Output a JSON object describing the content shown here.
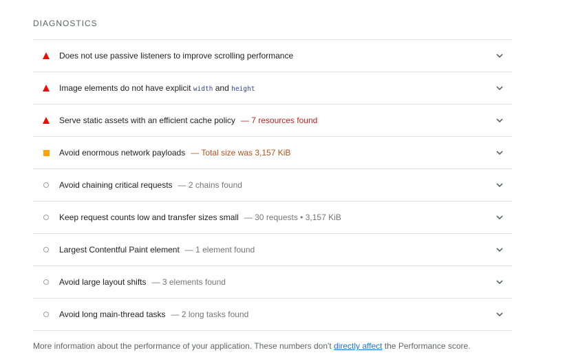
{
  "section": {
    "title": "DIAGNOSTICS"
  },
  "audits": [
    {
      "title": "Does not use passive listeners to improve scrolling performance",
      "display_value": "",
      "status": "fail"
    },
    {
      "title_before": "Image elements do not have explicit ",
      "code_1": "width",
      "title_middle": " and ",
      "code_2": "height",
      "display_value": "",
      "status": "fail"
    },
    {
      "title": "Serve static assets with an efficient cache policy",
      "display_value": "— 7 resources found",
      "status": "fail"
    },
    {
      "title": "Avoid enormous network payloads",
      "display_value": "— Total size was 3,157 KiB",
      "status": "average"
    },
    {
      "title": "Avoid chaining critical requests",
      "display_value": "— 2 chains found",
      "status": "informative"
    },
    {
      "title": "Keep request counts low and transfer sizes small",
      "display_value": "— 30 requests • 3,157 KiB",
      "status": "informative"
    },
    {
      "title": "Largest Contentful Paint element",
      "display_value": "— 1 element found",
      "status": "informative"
    },
    {
      "title": "Avoid large layout shifts",
      "display_value": "— 3 elements found",
      "status": "informative"
    },
    {
      "title": "Avoid long main-thread tasks",
      "display_value": "— 2 long tasks found",
      "status": "informative"
    }
  ],
  "footer": {
    "text_before": "More information about the performance of your application. These numbers don't ",
    "link_text": "directly affect",
    "text_after": " the Performance score."
  },
  "colors": {
    "fail": "#eb0f00",
    "average": "#ffa400",
    "informative": "#9e9e9e",
    "link": "#1a73e8"
  }
}
